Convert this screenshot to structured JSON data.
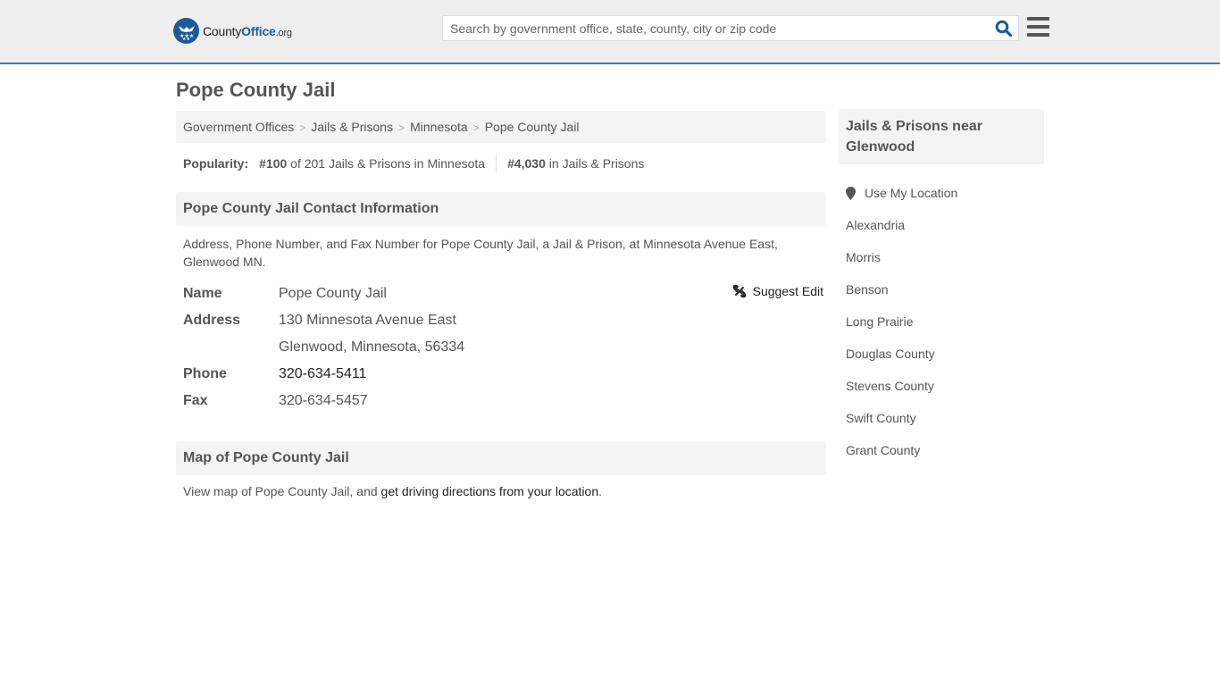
{
  "header": {
    "logo": {
      "text_main": "County",
      "text_brand": "Office",
      "text_tld": ".org"
    },
    "search": {
      "placeholder": "Search by government office, state, county, city or zip code",
      "value": ""
    },
    "accent_color": "#3a7bb0",
    "brand_color": "#1d5b96"
  },
  "page": {
    "title": "Pope County Jail"
  },
  "breadcrumb": [
    {
      "label": "Government Offices"
    },
    {
      "label": "Jails & Prisons"
    },
    {
      "label": "Minnesota"
    },
    {
      "label": "Pope County Jail"
    }
  ],
  "popularity": {
    "label": "Popularity:",
    "state_rank": "#100",
    "state_rank_text": "of 201 Jails & Prisons in Minnesota",
    "national_rank": "#4,030",
    "national_rank_text": "in Jails & Prisons"
  },
  "contact": {
    "heading": "Pope County Jail Contact Information",
    "description": "Address, Phone Number, and Fax Number for Pope County Jail, a Jail & Prison, at Minnesota Avenue East, Glenwood MN.",
    "suggest_edit": "Suggest Edit",
    "fields": {
      "name_label": "Name",
      "name_value": "Pope County Jail",
      "address_label": "Address",
      "address_line1": "130 Minnesota Avenue East",
      "address_line2": "Glenwood, Minnesota, 56334",
      "phone_label": "Phone",
      "phone_value": "320-634-5411",
      "fax_label": "Fax",
      "fax_value": "320-634-5457"
    }
  },
  "map": {
    "heading": "Map of Pope County Jail",
    "text_before": "View map of Pope County Jail, and ",
    "link_text": "get driving directions from your location",
    "text_after": "."
  },
  "sidebar": {
    "heading": "Jails & Prisons near Glenwood",
    "use_location": "Use My Location",
    "items": [
      {
        "label": "Alexandria"
      },
      {
        "label": "Morris"
      },
      {
        "label": "Benson"
      },
      {
        "label": "Long Prairie"
      },
      {
        "label": "Douglas County"
      },
      {
        "label": "Stevens County"
      },
      {
        "label": "Swift County"
      },
      {
        "label": "Grant County"
      }
    ]
  }
}
